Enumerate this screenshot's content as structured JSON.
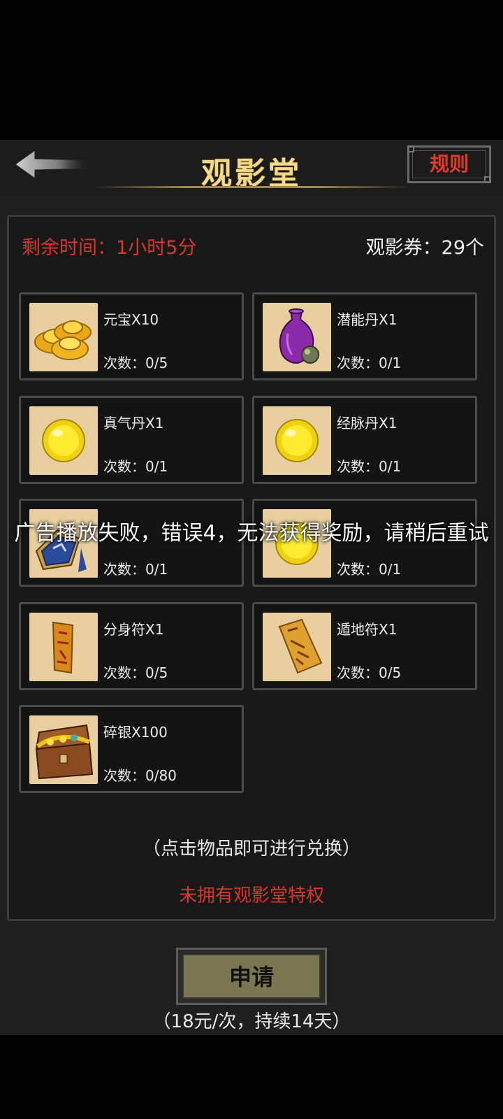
{
  "header": {
    "title": "观影堂",
    "rules_label": "规则"
  },
  "status": {
    "remaining_time": "剩余时间：1小时5分",
    "tickets": "观影券：29个"
  },
  "items": [
    {
      "name": "元宝X10",
      "count": "次数：0/5",
      "icon": "gold-ingot-icon"
    },
    {
      "name": "潜能丹X1",
      "count": "次数：0/1",
      "icon": "purple-vase-icon"
    },
    {
      "name": "真气丹X1",
      "count": "次数：0/1",
      "icon": "yellow-pill-icon"
    },
    {
      "name": "经脉丹X1",
      "count": "次数：0/1",
      "icon": "yellow-pill-icon"
    },
    {
      "name": "",
      "count": "次数：0/1",
      "icon": "blue-token-icon"
    },
    {
      "name": "",
      "count": "次数：0/1",
      "icon": "yellow-pill-icon"
    },
    {
      "name": "分身符X1",
      "count": "次数：0/5",
      "icon": "talisman-icon"
    },
    {
      "name": "遁地符X1",
      "count": "次数：0/5",
      "icon": "scroll-talisman-icon"
    },
    {
      "name": "碎银X100",
      "count": "次数：0/80",
      "icon": "treasure-chest-icon"
    }
  ],
  "hint": "（点击物品即可进行兑换）",
  "privilege_status": "未拥有观影堂特权",
  "apply_button": "申请",
  "price_note": "（18元/次，持续14天）",
  "toast": "广告播放失败，错误4，无法获得奖励，请稍后重试",
  "colors": {
    "title_gold": "#f3d98a",
    "alert_red": "#d8362a",
    "button_olive": "#7a7650"
  }
}
